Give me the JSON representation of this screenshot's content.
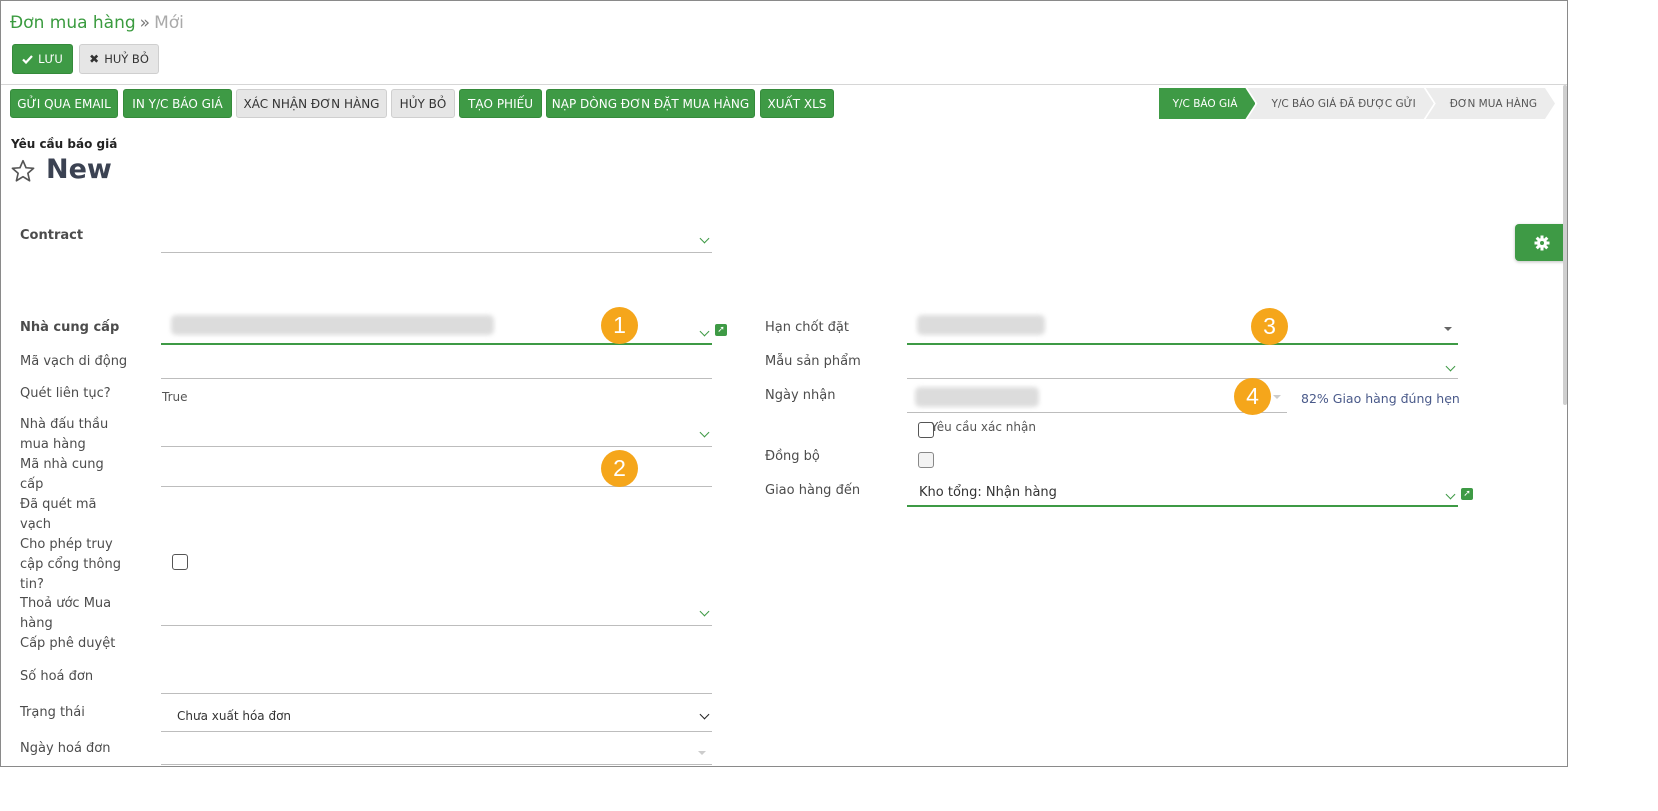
{
  "breadcrumb": {
    "parent": "Đơn mua hàng",
    "separator": "»",
    "current": "Mới"
  },
  "control": {
    "save_label": "LƯU",
    "discard_label": "HUỶ BỎ"
  },
  "actions": [
    {
      "label": "GỬI QUA EMAIL"
    },
    {
      "label": "IN Y/C BÁO GIÁ"
    },
    {
      "label": "XÁC NHẬN ĐƠN HÀNG"
    },
    {
      "label": "HỦY BỎ"
    },
    {
      "label": "TẠO PHIẾU"
    },
    {
      "label": "NẠP DÒNG ĐƠN ĐẶT MUA HÀNG"
    },
    {
      "label": "XUẤT XLS"
    }
  ],
  "stages": [
    {
      "label": "Y/C BÁO GIÁ",
      "active": true
    },
    {
      "label": "Y/C BÁO GIÁ ĐÃ ĐƯỢC GỬI",
      "active": false
    },
    {
      "label": "ĐƠN MUA HÀNG",
      "active": false
    }
  ],
  "document": {
    "type_label": "Yêu cầu báo giá",
    "title": "New"
  },
  "form": {
    "contract": {
      "label": "Contract"
    },
    "partner": {
      "label": "Nhà cung cấp"
    },
    "mobile_barcode": {
      "label": "Mã vạch di động"
    },
    "continuous_scan": {
      "label": "Quét liên tục?",
      "value": "True"
    },
    "bidder_line1": "Nhà đấu thầu",
    "bidder_line2": "mua hàng",
    "vendor_code_line1": "Mã nhà cung",
    "vendor_code_line2": "cấp",
    "scanned_line1": "Đã quét mã",
    "scanned_line2": "vạch",
    "portal_line1": "Cho phép truy",
    "portal_line2": "cập cổng thông",
    "portal_line3": "tin?",
    "agreement_line1": "Thoả ước Mua",
    "agreement_line2": "hàng",
    "approval_level": {
      "label": "Cấp phê duyệt"
    },
    "invoice_number": {
      "label": "Số hoá đơn"
    },
    "status": {
      "label": "Trạng thái",
      "value": "Chưa xuất hóa đơn"
    },
    "invoice_date": {
      "label": "Ngày hoá đơn"
    },
    "deadline": {
      "label": "Hạn chốt đặt"
    },
    "product_template": {
      "label": "Mẫu sản phẩm"
    },
    "receipt_date": {
      "label": "Ngày nhận",
      "on_time": "82% Giao hàng đúng hẹn"
    },
    "require_confirm": {
      "label": "Yêu cầu xác nhận"
    },
    "sync": {
      "label": "Đồng bộ"
    },
    "deliver_to": {
      "label": "Giao hàng đến",
      "value": "Kho tổng: Nhận hàng"
    }
  },
  "callouts": [
    "1",
    "2",
    "3",
    "4"
  ],
  "colors": {
    "accent": "#3e9a45",
    "callout": "#f5a61b"
  }
}
